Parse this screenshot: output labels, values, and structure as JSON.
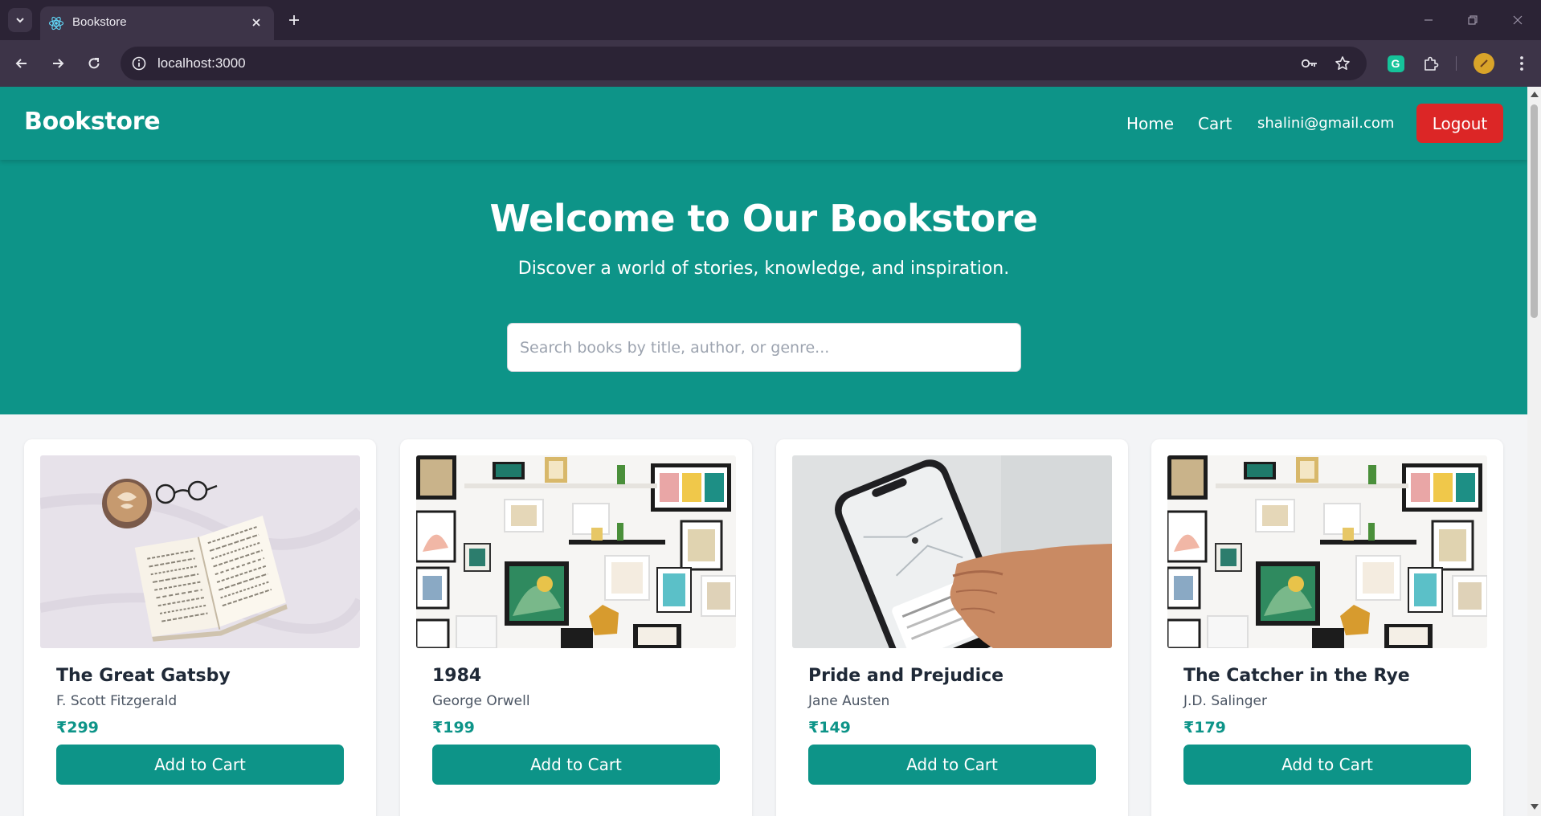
{
  "browser": {
    "tab_title": "Bookstore",
    "url": "localhost:3000"
  },
  "navbar": {
    "brand": "Bookstore",
    "links": [
      "Home",
      "Cart"
    ],
    "user_email": "shalini@gmail.com",
    "logout_label": "Logout"
  },
  "hero": {
    "title": "Welcome to Our Bookstore",
    "subtitle": "Discover a world of stories, knowledge, and inspiration.",
    "search_placeholder": "Search books by title, author, or genre..."
  },
  "books": [
    {
      "title": "The Great Gatsby",
      "author": "F. Scott Fitzgerald",
      "price": "₹299",
      "image": "coffee-book-glasses",
      "button": "Add to Cart"
    },
    {
      "title": "1984",
      "author": "George Orwell",
      "price": "₹199",
      "image": "gallery-wall",
      "button": "Add to Cart"
    },
    {
      "title": "Pride and Prejudice",
      "author": "Jane Austen",
      "price": "₹149",
      "image": "hand-holding-phone",
      "button": "Add to Cart"
    },
    {
      "title": "The Catcher in the Rye",
      "author": "J.D. Salinger",
      "price": "₹179",
      "image": "gallery-wall",
      "button": "Add to Cart"
    }
  ],
  "colors": {
    "primary": "#0d9488",
    "logout": "#dc2626",
    "background": "#f3f4f6",
    "chrome_dark": "#2b2335",
    "chrome_light": "#3d3448"
  }
}
